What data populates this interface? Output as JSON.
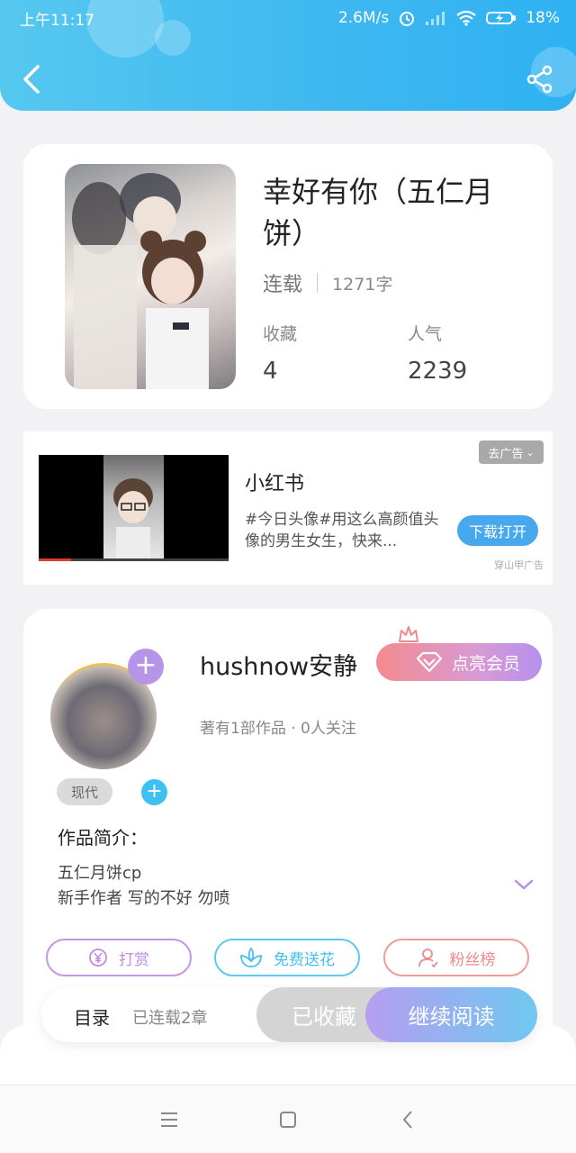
{
  "status_bar": {
    "time": "上午11:17",
    "speed": "2.6M/s",
    "battery": "18%"
  },
  "header": {
    "back_icon": "chevron-left-icon",
    "share_icon": "share-icon"
  },
  "book": {
    "title": "幸好有你（五仁月饼）",
    "status": "连载",
    "word_count": "1271字",
    "favorites_label": "收藏",
    "favorites_value": "4",
    "popularity_label": "人气",
    "popularity_value": "2239"
  },
  "ad": {
    "app_name": "小红书",
    "description": "#今日头像#用这么高颜值头像的男生女生，快来...",
    "download_label": "下载打开",
    "close_label": "去广告",
    "source": "穿山甲广告"
  },
  "author": {
    "name": "hushnow安静",
    "vip_label": "点亮会员",
    "meta": "著有1部作品 · 0人关注",
    "tag": "现代",
    "intro_title": "作品简介：",
    "intro_line1": "五仁月饼cp",
    "intro_line2": "新手作者 写的不好 勿喷",
    "tip_label": "打赏",
    "flower_label": "免费送花",
    "fans_label": "粉丝榜"
  },
  "reading_bar": {
    "toc_label": "目录",
    "toc_count": "已连载2章",
    "collected_label": "已收藏",
    "continue_label": "继续阅读"
  },
  "colors": {
    "header_blue": "#3db7f0",
    "accent_purple": "#b690ef",
    "accent_pink": "#f38b8f"
  }
}
